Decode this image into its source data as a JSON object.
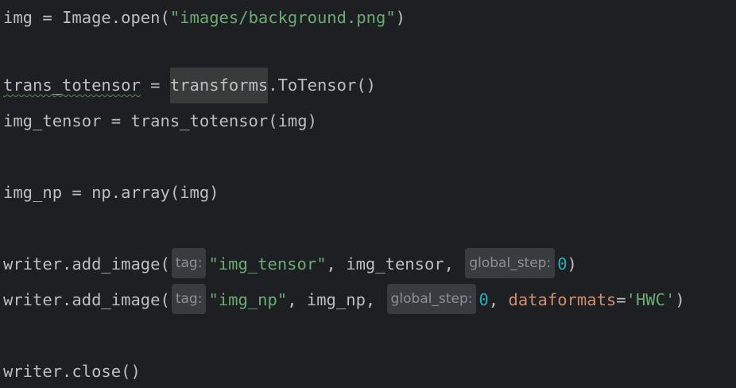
{
  "code": {
    "line1": {
      "var": "img",
      "op": " = ",
      "call": "Image.open(",
      "str": "\"images/background.png\"",
      "close": ")"
    },
    "line2": {
      "var": "trans_totensor",
      "op": " = ",
      "highlighted": "transforms",
      "rest": ".ToTensor()"
    },
    "line3": {
      "text": "img_tensor = trans_totensor(img)"
    },
    "line4": {
      "text": "img_np = np.array(img)"
    },
    "line5": {
      "call": "writer.add_image(",
      "hint_tag": "tag:",
      "str": "\"img_tensor\"",
      "mid": ", img_tensor, ",
      "hint_step": "global_step:",
      "num": "0",
      "close": ")"
    },
    "line6": {
      "call": "writer.add_image(",
      "hint_tag": "tag:",
      "str": "\"img_np\"",
      "mid": ", img_np, ",
      "hint_step": "global_step:",
      "num": "0",
      "sep": ", ",
      "kwarg": "dataformats",
      "eq": "=",
      "str2": "'HWC'",
      "close": ")"
    },
    "line7": {
      "text": "writer.close()"
    }
  },
  "colors": {
    "background": "#1e1f22",
    "default_text": "#bcbec4",
    "string": "#6aab73",
    "number": "#2aacb8",
    "keyword_arg": "#cf8e6d",
    "inlay_hint_bg": "#393b40",
    "inlay_hint_text": "#8c8f94",
    "identifier_highlight": "#373b39"
  }
}
